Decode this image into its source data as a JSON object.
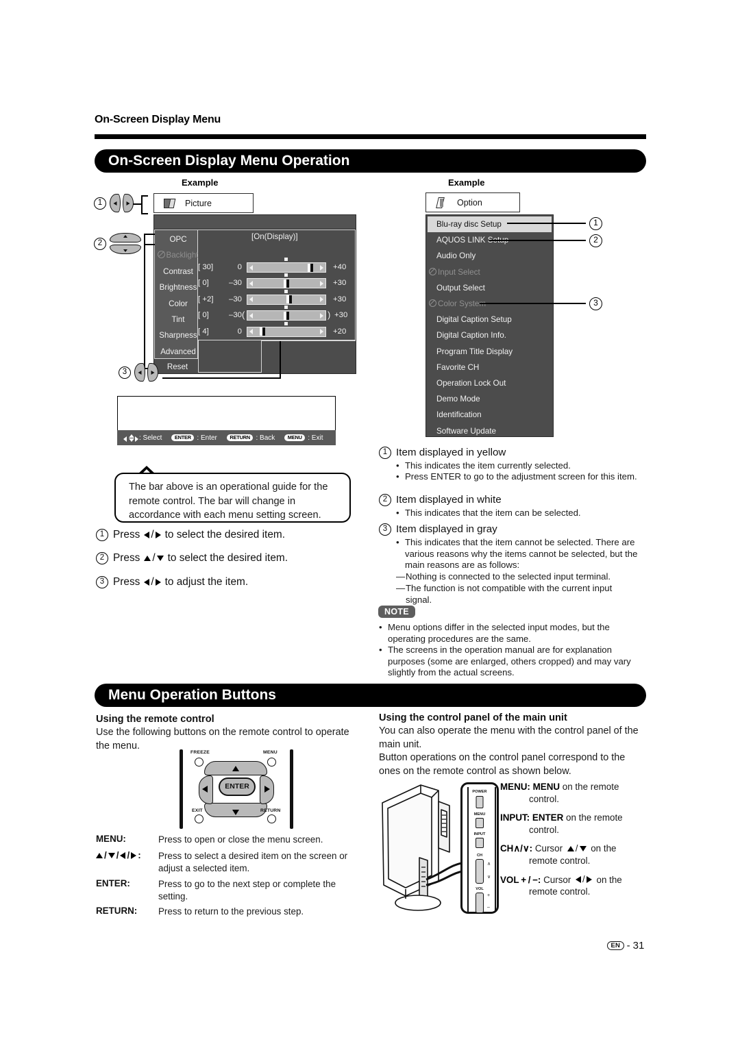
{
  "running_head": "On-Screen Display Menu",
  "banners": {
    "osd_operation": "On-Screen Display Menu Operation",
    "menu_operation_buttons": "Menu Operation Buttons"
  },
  "example_label_left": "Example",
  "example_label_right": "Example",
  "picture_menu": {
    "tab_label": "Picture",
    "tab_icon": "picture-tab-icon",
    "items": [
      {
        "label": "OPC",
        "state": "normal"
      },
      {
        "label": "Backlight",
        "state": "disabled",
        "icon": "prohibited-icon"
      },
      {
        "label": "Contrast",
        "state": "normal"
      },
      {
        "label": "Brightness",
        "state": "normal"
      },
      {
        "label": "Color",
        "state": "normal"
      },
      {
        "label": "Tint",
        "state": "normal"
      },
      {
        "label": "Sharpness",
        "state": "normal"
      },
      {
        "label": "Advanced",
        "state": "normal"
      },
      {
        "label": "Reset",
        "state": "normal"
      }
    ],
    "opc_value": "[On(Display)]",
    "sliders": [
      {
        "name": "Contrast",
        "value": "[ 30]",
        "min": "0",
        "max": "+40",
        "fill_pct": 76,
        "brackets": false
      },
      {
        "name": "Brightness",
        "value": "[  0]",
        "min": "–30",
        "max": "+30",
        "fill_pct": 50,
        "brackets": false
      },
      {
        "name": "Color",
        "value": "[ +2]",
        "min": "–30",
        "max": "+30",
        "fill_pct": 53,
        "brackets": false
      },
      {
        "name": "Tint",
        "value": "[  0]",
        "min": "–30",
        "max": "+30",
        "fill_pct": 50,
        "brackets": true
      },
      {
        "name": "Sharpness",
        "value": "[  4]",
        "min": "0",
        "max": "+20",
        "fill_pct": 16,
        "brackets": false
      }
    ]
  },
  "guide_bar": {
    "select_label": ": Select",
    "enter_key": "ENTER",
    "enter_label": ": Enter",
    "return_key": "RETURN",
    "return_label": ": Back",
    "menu_key": "MENU",
    "menu_label": ": Exit"
  },
  "balloon_text": "The bar above is an operational guide for the remote control. The bar will change in accordance with each menu setting screen.",
  "left_steps": [
    {
      "num": "1",
      "pre": "Press",
      "keys": "left-right",
      "post": "to select the desired item."
    },
    {
      "num": "2",
      "pre": "Press",
      "keys": "up-down",
      "post": "to select the desired item."
    },
    {
      "num": "3",
      "pre": "Press",
      "keys": "left-right",
      "post": "to adjust the item."
    }
  ],
  "option_menu": {
    "tab_label": "Option",
    "tab_icon": "option-tab-icon",
    "items": [
      {
        "label": "Blu-ray disc Setup",
        "state": "selected"
      },
      {
        "label": "AQUOS LINK Setup",
        "state": "normal"
      },
      {
        "label": "Audio Only",
        "state": "normal"
      },
      {
        "label": "Input Select",
        "state": "disabled",
        "icon": "prohibited-icon"
      },
      {
        "label": "Output Select",
        "state": "normal"
      },
      {
        "label": "Color System",
        "state": "disabled",
        "icon": "prohibited-icon"
      },
      {
        "label": "Digital Caption Setup",
        "state": "normal"
      },
      {
        "label": "Digital Caption Info.",
        "state": "normal"
      },
      {
        "label": "Program Title Display",
        "state": "normal"
      },
      {
        "label": "Favorite CH",
        "state": "normal"
      },
      {
        "label": "Operation Lock Out",
        "state": "normal"
      },
      {
        "label": "Demo Mode",
        "state": "normal"
      },
      {
        "label": "Identification",
        "state": "normal"
      },
      {
        "label": "Software Update",
        "state": "normal"
      }
    ],
    "callouts": [
      "1",
      "2",
      "3"
    ]
  },
  "legend": [
    {
      "num": "1",
      "title": "Item displayed in yellow",
      "bullets": [
        "This indicates the item currently selected.",
        "Press ENTER to go to the adjustment screen for this item."
      ]
    },
    {
      "num": "2",
      "title": "Item displayed in white",
      "bullets": [
        "This indicates that the item can be selected."
      ]
    },
    {
      "num": "3",
      "title": "Item displayed in gray",
      "bullets": [
        "This indicates that the item cannot be selected. There are various reasons why the items cannot be selected, but the main reasons are as follows:"
      ],
      "dashes": [
        "Nothing is connected to the selected input terminal.",
        "The function is not compatible with the current input signal."
      ]
    }
  ],
  "note": {
    "tag": "NOTE",
    "bullets": [
      "Menu options differ in the selected input modes, but the operating procedures are the same.",
      "The screens in the operation manual are for explanation purposes (some are enlarged, others cropped) and may vary slightly from the actual screens."
    ]
  },
  "remote_section": {
    "heading": "Using the remote control",
    "intro": "Use the following buttons on the remote control to operate the menu.",
    "remote_labels": {
      "freeze": "FREEZE",
      "menu": "MENU",
      "exit": "EXIT",
      "return": "RETURN",
      "enter": "ENTER"
    },
    "buttons": [
      {
        "key": "MENU:",
        "desc": "Press to open or close the menu screen."
      },
      {
        "key": "arrows",
        "desc": "Press to select a desired item on the screen or adjust a selected item."
      },
      {
        "key": "ENTER:",
        "desc": "Press to go to the next step or complete the setting."
      },
      {
        "key": "RETURN:",
        "desc": "Press to return to the previous step."
      }
    ]
  },
  "panel_section": {
    "heading": "Using the control panel of the main unit",
    "intro1": "You can also operate the menu with the control panel of the main unit.",
    "intro2": "Button operations on the control panel correspond to the ones on the remote control as shown below.",
    "panel_labels": [
      "POWER",
      "MENU",
      "INPUT",
      "CH",
      "VOL"
    ],
    "panel_marks": {
      "ch_up": "∧",
      "ch_down": "∨",
      "vol_plus": "+",
      "vol_minus": "–"
    },
    "correspondence": [
      {
        "key": "MENU:",
        "maps": "MENU",
        "tail": " on the remote",
        "tail2": "control."
      },
      {
        "key": "INPUT:",
        "maps": "ENTER",
        "tail": " on the remote",
        "tail2": "control."
      },
      {
        "key": "CH∧/∨:",
        "maps": "cursor-up-down",
        "tail": " on the",
        "tail2": "remote control.",
        "prefix": "Cursor"
      },
      {
        "key": "VOL + / −:",
        "maps": "cursor-left-right",
        "tail": " on the",
        "tail2": "remote control.",
        "prefix": "Cursor"
      }
    ]
  },
  "footer": {
    "badge": "EN",
    "sep": "-",
    "page": "31"
  }
}
